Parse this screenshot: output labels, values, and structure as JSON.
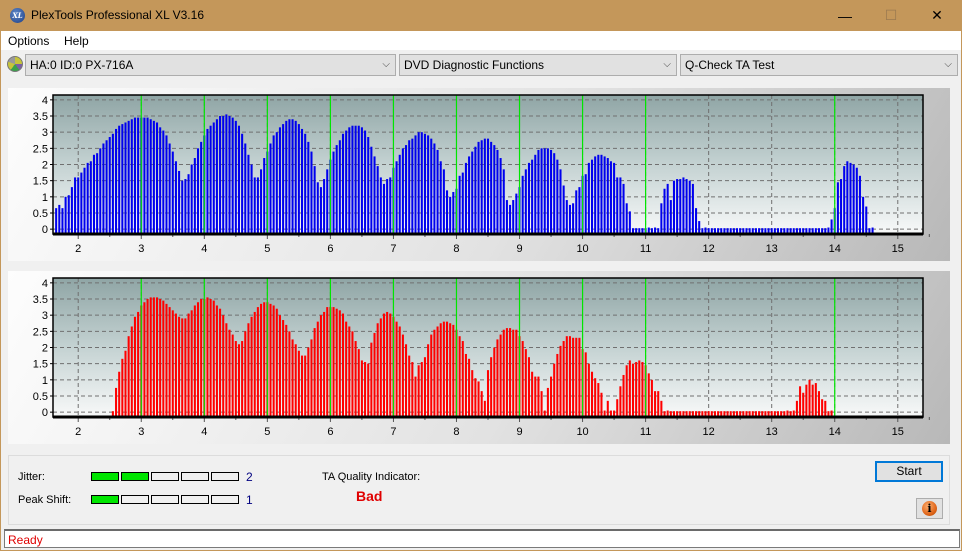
{
  "window": {
    "title": "PlexTools Professional XL V3.16",
    "app_icon_text": "XL",
    "minimize_glyph": "—",
    "maximize_glyph": "☐",
    "close_glyph": "✕"
  },
  "menu": {
    "items": [
      "Options",
      "Help"
    ]
  },
  "toolbar": {
    "drive_select": "HA:0 ID:0  PX-716A",
    "function_select": "DVD Diagnostic Functions",
    "test_select": "Q-Check TA Test",
    "chevron": "⌵"
  },
  "results": {
    "jitter_label": "Jitter:",
    "jitter_value": "2",
    "jitter_level": 2,
    "peak_shift_label": "Peak Shift:",
    "peak_shift_value": "1",
    "peak_shift_level": 1,
    "meter_segments": 5,
    "ta_quality_label": "TA Quality Indicator:",
    "ta_quality_value": "Bad"
  },
  "buttons": {
    "start": "Start",
    "info_glyph": "i"
  },
  "status": {
    "text": "Ready"
  },
  "colors": {
    "top_bars": "#0000ee",
    "bottom_bars": "#ff0000",
    "marker_lines": "#00e600",
    "meter_on": "#00e600",
    "bad": "#e00000"
  },
  "chart_data": [
    {
      "type": "bar",
      "name": "top-ta-histogram",
      "title": "",
      "xlabel": "",
      "ylabel": "",
      "xlim": [
        1.6,
        15.4
      ],
      "ylim": [
        -0.15,
        4.15
      ],
      "xticks": [
        2,
        3,
        4,
        5,
        6,
        7,
        8,
        9,
        10,
        11,
        12,
        13,
        14,
        15
      ],
      "yticks": [
        0,
        0.5,
        1,
        1.5,
        2,
        2.5,
        3,
        3.5,
        4
      ],
      "ytick_labels": [
        "0",
        "0.5",
        "1",
        "1.5",
        "2",
        "2.5",
        "3",
        "3.5",
        "4"
      ],
      "grid": true,
      "marker_lines_x": [
        3,
        4,
        5,
        6,
        7,
        8,
        9,
        10,
        11,
        14
      ],
      "x_start": 1.65,
      "x_step": 0.05,
      "values": [
        0.65,
        0.75,
        0.65,
        1.0,
        1.05,
        1.3,
        1.6,
        1.6,
        1.75,
        1.9,
        2.05,
        2.1,
        2.3,
        2.35,
        2.5,
        2.65,
        2.75,
        2.85,
        2.95,
        3.1,
        3.2,
        3.25,
        3.3,
        3.35,
        3.4,
        3.45,
        3.45,
        3.45,
        3.45,
        3.45,
        3.4,
        3.35,
        3.3,
        3.15,
        3.05,
        2.9,
        2.65,
        2.4,
        2.1,
        1.8,
        1.5,
        1.55,
        1.7,
        2.0,
        2.2,
        2.5,
        2.7,
        2.9,
        3.1,
        3.2,
        3.3,
        3.4,
        3.5,
        3.5,
        3.55,
        3.5,
        3.45,
        3.35,
        3.2,
        2.95,
        2.65,
        2.3,
        2.0,
        1.6,
        1.6,
        1.85,
        2.2,
        2.4,
        2.65,
        2.9,
        3.0,
        3.15,
        3.25,
        3.35,
        3.4,
        3.4,
        3.35,
        3.25,
        3.1,
        2.95,
        2.7,
        2.4,
        1.95,
        1.45,
        1.3,
        1.55,
        1.85,
        2.15,
        2.4,
        2.6,
        2.75,
        2.95,
        3.05,
        3.15,
        3.2,
        3.2,
        3.2,
        3.15,
        3.05,
        2.85,
        2.55,
        2.25,
        1.95,
        1.6,
        1.4,
        1.55,
        1.6,
        1.9,
        2.1,
        2.3,
        2.5,
        2.6,
        2.75,
        2.8,
        2.9,
        3.0,
        3.0,
        2.95,
        2.9,
        2.8,
        2.65,
        2.45,
        2.1,
        1.85,
        1.2,
        1.0,
        1.15,
        1.25,
        1.65,
        1.75,
        2.05,
        2.25,
        2.4,
        2.55,
        2.7,
        2.75,
        2.8,
        2.8,
        2.7,
        2.6,
        2.45,
        2.2,
        1.85,
        0.9,
        0.75,
        0.9,
        1.1,
        1.3,
        1.65,
        1.85,
        2.05,
        2.15,
        2.3,
        2.45,
        2.5,
        2.5,
        2.5,
        2.45,
        2.35,
        2.15,
        1.85,
        1.35,
        0.9,
        0.75,
        0.8,
        1.2,
        1.3,
        1.65,
        1.7,
        2.05,
        2.15,
        2.25,
        2.3,
        2.3,
        2.25,
        2.2,
        2.1,
        2.05,
        1.6,
        1.6,
        1.4,
        0.8,
        0.55,
        0.0,
        0.0,
        0.0,
        0.0,
        0.0,
        0.05,
        0.0,
        0.05,
        0.0,
        0.8,
        1.25,
        1.4,
        0.9,
        1.5,
        1.55,
        1.55,
        1.6,
        1.55,
        1.5,
        1.4,
        0.65,
        0.25,
        0.0,
        0.05,
        0.0,
        0.0,
        0.0,
        0.0,
        0.0,
        0.0,
        0.0,
        0.0,
        0.0,
        0.0,
        0.0,
        0.0,
        0.0,
        0.0,
        0.0,
        0.0,
        0.0,
        0.0,
        0.0,
        0.0,
        0.0,
        0.0,
        0.0,
        0.0,
        0.0,
        0.0,
        0.0,
        0.0,
        0.0,
        0.0,
        0.0,
        0.0,
        0.0,
        0.0,
        0.0,
        0.0,
        0.0,
        0.0,
        0.05,
        0.3,
        0.65,
        1.45,
        1.55,
        1.95,
        2.1,
        2.05,
        2.0,
        1.9,
        1.65,
        1.0,
        0.7,
        0.0,
        0.05
      ]
    },
    {
      "type": "bar",
      "name": "bottom-ta-histogram",
      "title": "",
      "xlabel": "",
      "ylabel": "",
      "xlim": [
        1.6,
        15.4
      ],
      "ylim": [
        -0.15,
        4.15
      ],
      "xticks": [
        2,
        3,
        4,
        5,
        6,
        7,
        8,
        9,
        10,
        11,
        12,
        13,
        14,
        15
      ],
      "yticks": [
        0,
        0.5,
        1,
        1.5,
        2,
        2.5,
        3,
        3.5,
        4
      ],
      "ytick_labels": [
        "0",
        "0.5",
        "1",
        "1.5",
        "2",
        "2.5",
        "3",
        "3.5",
        "4"
      ],
      "grid": true,
      "marker_lines_x": [
        3,
        4,
        5,
        6,
        7,
        8,
        9,
        10,
        11,
        14
      ],
      "x_start": 2.55,
      "x_step": 0.05,
      "values": [
        0.0,
        0.75,
        1.25,
        1.65,
        1.9,
        2.35,
        2.65,
        2.95,
        3.1,
        3.3,
        3.4,
        3.5,
        3.55,
        3.55,
        3.55,
        3.5,
        3.45,
        3.35,
        3.25,
        3.15,
        3.05,
        2.95,
        2.9,
        2.9,
        3.05,
        3.15,
        3.3,
        3.4,
        3.5,
        3.5,
        3.55,
        3.5,
        3.45,
        3.3,
        3.2,
        3.0,
        2.75,
        2.55,
        2.4,
        2.2,
        2.1,
        2.2,
        2.5,
        2.75,
        2.95,
        3.1,
        3.25,
        3.35,
        3.4,
        3.4,
        3.35,
        3.3,
        3.2,
        3.0,
        2.85,
        2.7,
        2.5,
        2.25,
        2.1,
        1.9,
        1.75,
        1.75,
        2.0,
        2.25,
        2.6,
        2.8,
        3.0,
        3.1,
        3.25,
        3.25,
        3.25,
        3.2,
        3.15,
        3.05,
        2.8,
        2.65,
        2.5,
        2.2,
        1.95,
        1.6,
        1.55,
        1.5,
        2.15,
        2.45,
        2.75,
        2.9,
        3.05,
        3.1,
        3.05,
        2.95,
        2.8,
        2.65,
        2.4,
        2.1,
        1.75,
        1.55,
        1.1,
        1.45,
        1.55,
        1.7,
        2.1,
        2.4,
        2.55,
        2.65,
        2.75,
        2.8,
        2.8,
        2.75,
        2.7,
        2.55,
        2.35,
        2.2,
        1.8,
        1.65,
        1.3,
        1.05,
        0.95,
        0.65,
        0.35,
        1.3,
        1.7,
        2.0,
        2.25,
        2.4,
        2.55,
        2.6,
        2.6,
        2.55,
        2.55,
        2.35,
        2.2,
        1.95,
        1.7,
        1.25,
        1.1,
        1.1,
        0.65,
        0.05,
        0.75,
        1.1,
        1.5,
        1.8,
        2.05,
        2.2,
        2.35,
        2.35,
        2.3,
        2.3,
        2.3,
        1.95,
        1.85,
        1.5,
        1.25,
        1.05,
        0.9,
        0.6,
        0.05,
        0.35,
        0.05,
        0.05,
        0.4,
        0.8,
        1.15,
        1.45,
        1.6,
        1.5,
        1.55,
        1.6,
        1.55,
        1.45,
        1.2,
        1.0,
        0.65,
        0.65,
        0.35,
        0.0,
        0.05,
        0.0,
        0.0,
        0.0,
        0.0,
        0.0,
        0.0,
        0.0,
        0.0,
        0.0,
        0.0,
        0.0,
        0.0,
        0.0,
        0.0,
        0.0,
        0.0,
        0.0,
        0.0,
        0.0,
        0.0,
        0.0,
        0.0,
        0.0,
        0.0,
        0.0,
        0.0,
        0.0,
        0.0,
        0.0,
        0.0,
        0.0,
        0.0,
        0.0,
        0.0,
        0.0,
        0.0,
        0.0,
        0.05,
        0.0,
        0.05,
        0.35,
        0.8,
        0.6,
        0.85,
        1.0,
        0.85,
        0.9,
        0.65,
        0.4,
        0.35,
        0.0,
        0.05
      ]
    }
  ]
}
